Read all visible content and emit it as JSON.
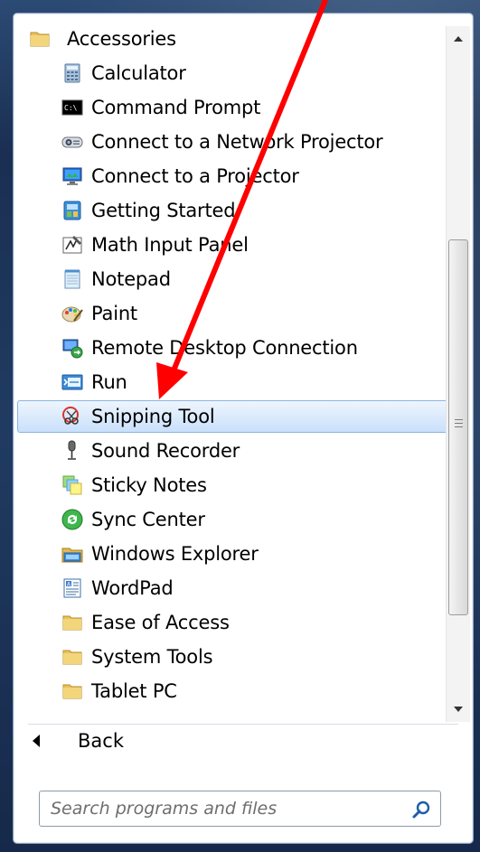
{
  "folder": {
    "label": "Accessories",
    "icon": "folder-icon"
  },
  "items": [
    {
      "label": "Calculator",
      "icon": "calculator-icon"
    },
    {
      "label": "Command Prompt",
      "icon": "command-prompt-icon"
    },
    {
      "label": "Connect to a Network Projector",
      "icon": "network-projector-icon"
    },
    {
      "label": "Connect to a Projector",
      "icon": "projector-icon"
    },
    {
      "label": "Getting Started",
      "icon": "getting-started-icon"
    },
    {
      "label": "Math Input Panel",
      "icon": "math-input-icon"
    },
    {
      "label": "Notepad",
      "icon": "notepad-icon"
    },
    {
      "label": "Paint",
      "icon": "paint-icon"
    },
    {
      "label": "Remote Desktop Connection",
      "icon": "remote-desktop-icon"
    },
    {
      "label": "Run",
      "icon": "run-icon"
    },
    {
      "label": "Snipping Tool",
      "icon": "snipping-tool-icon",
      "selected": true
    },
    {
      "label": "Sound Recorder",
      "icon": "microphone-icon"
    },
    {
      "label": "Sticky Notes",
      "icon": "sticky-notes-icon"
    },
    {
      "label": "Sync Center",
      "icon": "sync-center-icon"
    },
    {
      "label": "Windows Explorer",
      "icon": "windows-explorer-icon"
    },
    {
      "label": "WordPad",
      "icon": "wordpad-icon"
    },
    {
      "label": "Ease of Access",
      "icon": "folder-icon"
    },
    {
      "label": "System Tools",
      "icon": "folder-icon"
    },
    {
      "label": "Tablet PC",
      "icon": "folder-icon"
    }
  ],
  "back_label": "Back",
  "search": {
    "placeholder": "Search programs and files"
  },
  "colors": {
    "selection_border": "#8cb4e0",
    "annotation_arrow": "#ff0000",
    "frame": "#1a2f52"
  }
}
